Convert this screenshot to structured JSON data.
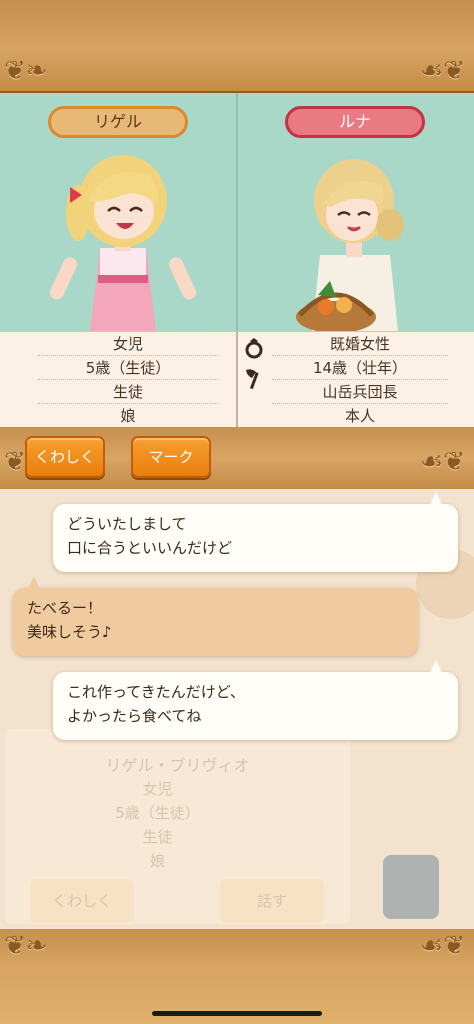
{
  "left_character": {
    "name": "リゲル",
    "info": [
      "女児",
      "5歳（生徒）",
      "生徒",
      "娘"
    ]
  },
  "right_character": {
    "name": "ルナ",
    "info": [
      "既婚女性",
      "14歳（壮年）",
      "山岳兵団長",
      "本人"
    ],
    "icons": [
      "ring-icon",
      "axe-icon"
    ]
  },
  "buttons": {
    "details": "くわしく",
    "mark": "マーク"
  },
  "messages": [
    {
      "speaker": "right",
      "lines": [
        "どういたしまして",
        "口に合うといいんだけど"
      ]
    },
    {
      "speaker": "left",
      "lines": [
        "たべるー！",
        "美味しそう♪"
      ]
    },
    {
      "speaker": "right",
      "lines": [
        "これ作ってきたんだけど、",
        "よかったら食べてね"
      ]
    }
  ],
  "background_panel": {
    "name": "リゲル・ブリヴィオ",
    "info": [
      "女児",
      "5歳（生徒）",
      "生徒",
      "娘"
    ],
    "details_button": "くわしく",
    "talk_button": "話す"
  },
  "colors": {
    "wood": "#d7a462",
    "mint": "#a9d8c8",
    "orange_button": "#f39a2a",
    "left_pill": "#e8b876",
    "right_pill": "#e97a82"
  }
}
